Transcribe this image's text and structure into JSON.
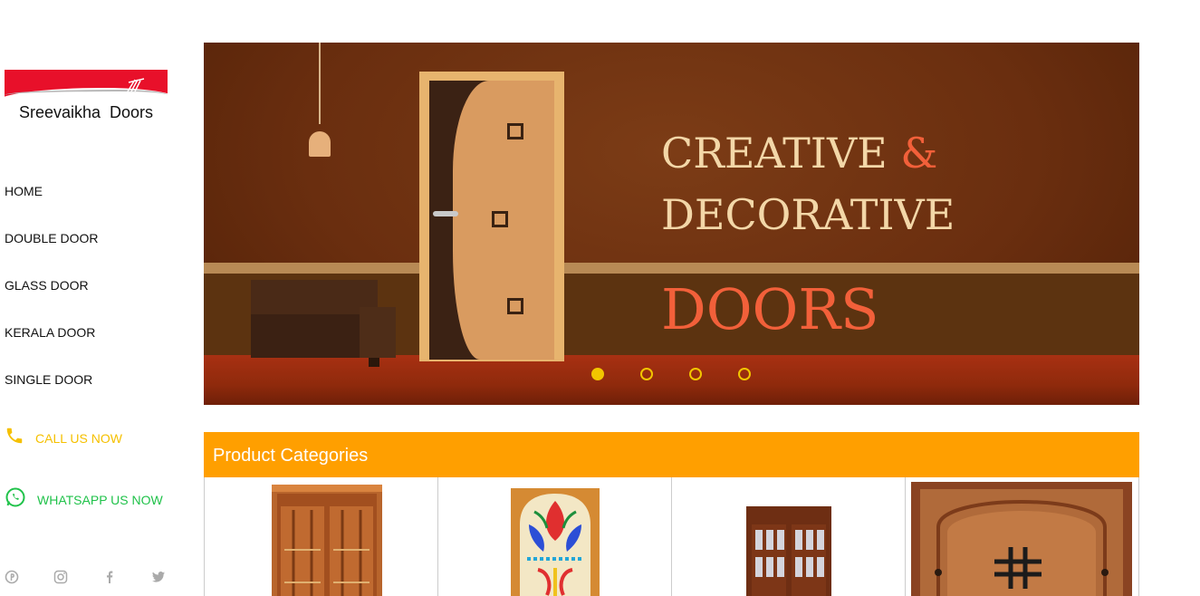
{
  "brand": {
    "name": "Sreevaikha  Doors"
  },
  "nav": [
    {
      "label": "HOME"
    },
    {
      "label": "DOUBLE DOOR"
    },
    {
      "label": "GLASS DOOR"
    },
    {
      "label": "KERALA DOOR"
    },
    {
      "label": "SINGLE DOOR"
    }
  ],
  "contact": {
    "call_label": "CALL US NOW",
    "whatsapp_label": "WHATSAPP US NOW"
  },
  "social": [
    "pinterest-icon",
    "instagram-icon",
    "facebook-icon",
    "twitter-icon"
  ],
  "banner": {
    "line1": "CREATIVE",
    "ampersand": "&",
    "line2": "DECORATIVE",
    "line3": "DOORS",
    "slides": 4,
    "active_slide": 1
  },
  "categories": {
    "title": "Product Categories",
    "items": [
      "double-door-thumb",
      "glass-door-thumb",
      "kerala-door-thumb",
      "single-door-thumb"
    ]
  },
  "colors": {
    "accent": "#ff9f00",
    "call": "#f5c000",
    "whatsapp": "#20c24a",
    "banner_red": "#f2603a"
  }
}
